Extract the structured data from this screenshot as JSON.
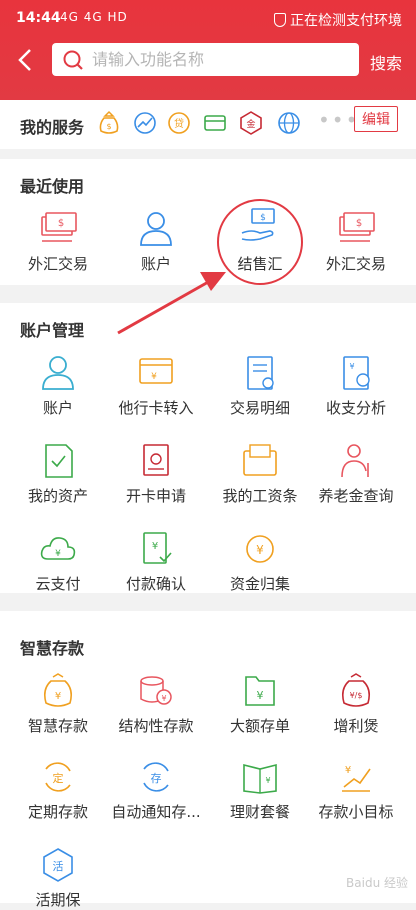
{
  "status_bar": {
    "time": "14:44",
    "signal": "4G 4G HD",
    "right_text": "正在检测支付环境"
  },
  "header": {
    "search_placeholder": "请输入功能名称",
    "search_button": "搜索"
  },
  "my_services": {
    "title": "我的服务",
    "edit_label": "编辑",
    "icons": [
      "money-bag-icon",
      "trend-icon",
      "loan-icon",
      "card-icon",
      "gold-icon",
      "globe-icon"
    ]
  },
  "recent": {
    "title": "最近使用",
    "items": [
      {
        "label": "外汇交易",
        "icon": "forex-icon"
      },
      {
        "label": "账户",
        "icon": "account-icon"
      },
      {
        "label": "结售汇",
        "icon": "exchange-settlement-icon"
      },
      {
        "label": "外汇交易",
        "icon": "forex-icon"
      }
    ]
  },
  "account_mgmt": {
    "title": "账户管理",
    "items": [
      {
        "label": "账户",
        "icon": "account-icon"
      },
      {
        "label": "他行卡转入",
        "icon": "card-transfer-icon"
      },
      {
        "label": "交易明细",
        "icon": "transaction-detail-icon"
      },
      {
        "label": "收支分析",
        "icon": "analysis-icon"
      },
      {
        "label": "我的资产",
        "icon": "asset-icon"
      },
      {
        "label": "开卡申请",
        "icon": "card-apply-icon"
      },
      {
        "label": "我的工资条",
        "icon": "payslip-icon"
      },
      {
        "label": "养老金查询",
        "icon": "pension-icon"
      },
      {
        "label": "云支付",
        "icon": "cloud-pay-icon"
      },
      {
        "label": "付款确认",
        "icon": "payment-confirm-icon"
      },
      {
        "label": "资金归集",
        "icon": "fund-collect-icon"
      }
    ]
  },
  "smart_deposit": {
    "title": "智慧存款",
    "items": [
      {
        "label": "智慧存款",
        "icon": "smart-deposit-icon"
      },
      {
        "label": "结构性存款",
        "icon": "structured-deposit-icon"
      },
      {
        "label": "大额存单",
        "icon": "large-deposit-icon"
      },
      {
        "label": "增利煲",
        "icon": "interest-pot-icon"
      },
      {
        "label": "定期存款",
        "icon": "fixed-deposit-icon"
      },
      {
        "label": "自动通知存...",
        "icon": "auto-notice-deposit-icon"
      },
      {
        "label": "理财套餐",
        "icon": "finance-package-icon"
      },
      {
        "label": "存款小目标",
        "icon": "deposit-goal-icon"
      },
      {
        "label": "活期保",
        "icon": "current-deposit-icon"
      }
    ]
  },
  "colors": {
    "brand_red": "#e23a43",
    "icon_blue": "#3a8ee6",
    "icon_orange": "#f0a020",
    "icon_green": "#3caa4a"
  },
  "watermark": "Baidu 经验"
}
